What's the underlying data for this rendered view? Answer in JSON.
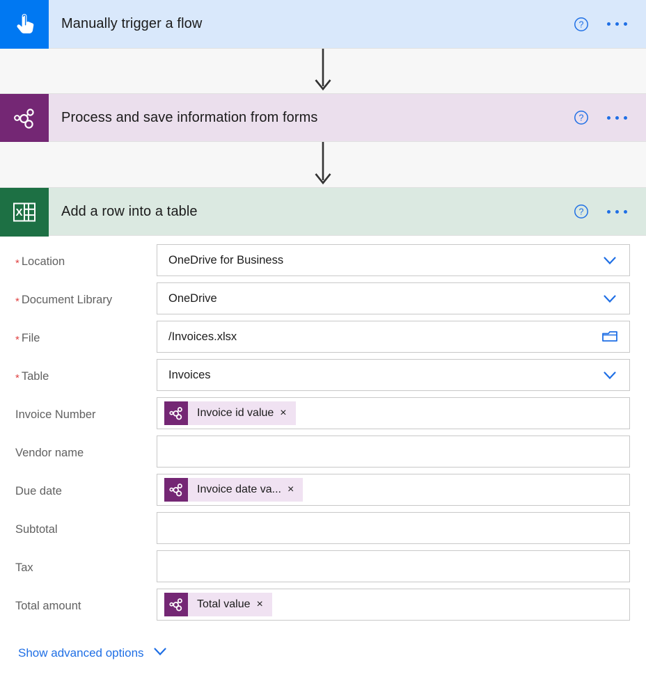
{
  "flow": {
    "cards": [
      {
        "id": "manual-trigger",
        "title": "Manually trigger a flow",
        "icon": "touch-tap-icon",
        "icon_bg": "#0078f2",
        "header_bg": "#d9e8fb",
        "help_label": "?",
        "more_label": "..."
      },
      {
        "id": "ai-builder-forms",
        "title": "Process and save information from forms",
        "icon": "ai-builder-icon",
        "icon_bg": "#742774",
        "header_bg": "#ebdfed",
        "help_label": "?",
        "more_label": "..."
      },
      {
        "id": "excel-add-row",
        "title": "Add a row into a table",
        "icon": "excel-icon",
        "icon_bg": "#1d7044",
        "header_bg": "#dbe9e1",
        "help_label": "?",
        "more_label": "..."
      }
    ],
    "connectors": [
      {
        "from": "manual-trigger",
        "to": "ai-builder-forms",
        "icon": "down-arrow-icon"
      },
      {
        "from": "ai-builder-forms",
        "to": "excel-add-row",
        "icon": "down-arrow-icon"
      }
    ]
  },
  "form": {
    "fields": [
      {
        "label": "Location",
        "required": true,
        "value": "OneDrive for Business",
        "placeholder": "",
        "control": "dropdown",
        "affordance": "chevron-down-icon",
        "token": null
      },
      {
        "label": "Document Library",
        "required": true,
        "value": "OneDrive",
        "placeholder": "",
        "control": "dropdown",
        "affordance": "chevron-down-icon",
        "token": null
      },
      {
        "label": "File",
        "required": true,
        "value": "/Invoices.xlsx",
        "placeholder": "",
        "control": "file-picker",
        "affordance": "folder-icon",
        "token": null
      },
      {
        "label": "Table",
        "required": true,
        "value": "Invoices",
        "placeholder": "",
        "control": "dropdown",
        "affordance": "chevron-down-icon",
        "token": null
      },
      {
        "label": "Invoice Number",
        "required": false,
        "value": "",
        "placeholder": "",
        "control": "token-input",
        "affordance": "",
        "token": {
          "label": "Invoice id value",
          "icon": "ai-builder-icon",
          "remove_label": "×"
        }
      },
      {
        "label": "Vendor name",
        "required": false,
        "value": "",
        "placeholder": "",
        "control": "text",
        "affordance": "",
        "token": null
      },
      {
        "label": "Due date",
        "required": false,
        "value": "",
        "placeholder": "",
        "control": "token-input",
        "affordance": "",
        "token": {
          "label": "Invoice date va...",
          "icon": "ai-builder-icon",
          "remove_label": "×"
        }
      },
      {
        "label": "Subtotal",
        "required": false,
        "value": "",
        "placeholder": "",
        "control": "text",
        "affordance": "",
        "token": null
      },
      {
        "label": "Tax",
        "required": false,
        "value": "",
        "placeholder": "",
        "control": "text",
        "affordance": "",
        "token": null
      },
      {
        "label": "Total amount",
        "required": false,
        "value": "",
        "placeholder": "",
        "control": "token-input",
        "affordance": "",
        "token": {
          "label": "Total value",
          "icon": "ai-builder-icon",
          "remove_label": "×"
        }
      }
    ],
    "advanced_options": {
      "label": "Show advanced options",
      "icon": "chevron-down-icon",
      "color": "#1f6fe5"
    },
    "required_marker": "*"
  },
  "colors": {
    "trigger_header": "#d9e8fb",
    "trigger_icon": "#0078f2",
    "aibuilder_header": "#ebdfed",
    "aibuilder_icon": "#742774",
    "excel_header": "#dbe9e1",
    "excel_icon": "#1d7044",
    "link": "#1f6fe5",
    "required_star": "#e04343",
    "token_bg": "#f0e2f2",
    "gap_bg": "#f7f7f7"
  }
}
